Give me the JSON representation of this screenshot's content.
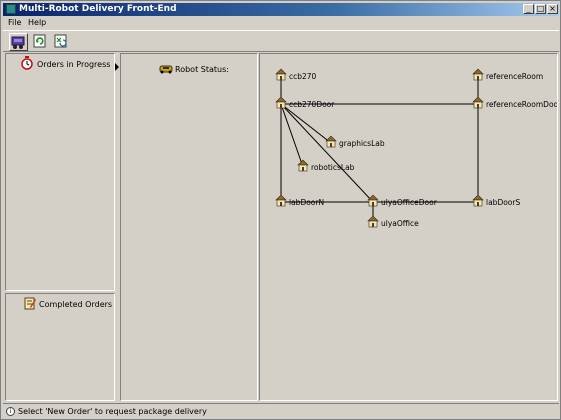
{
  "window": {
    "title": "Multi-Robot Delivery Front-End",
    "controls": [
      "_",
      "□",
      "×"
    ]
  },
  "menu": {
    "file": "File",
    "help": "Help"
  },
  "toolbar": {
    "buttons": [
      {
        "icon": "robot-cart-icon"
      },
      {
        "icon": "refresh-icon"
      },
      {
        "icon": "reset-icon"
      }
    ]
  },
  "left_panel": {
    "orders_in_progress": "Orders in Progress",
    "completed_orders": "Completed Orders"
  },
  "robot_panel": {
    "robot_status_label": "Robot Status:"
  },
  "map": {
    "nodes": [
      {
        "id": "ccb270",
        "label": "ccb270"
      },
      {
        "id": "referenceRoom",
        "label": "referenceRoom"
      },
      {
        "id": "ccb270Door",
        "label": "ccb270Door"
      },
      {
        "id": "referenceRoomDoor",
        "label": "referenceRoomDoor"
      },
      {
        "id": "graphicsLab",
        "label": "graphicsLab"
      },
      {
        "id": "roboticsLab",
        "label": "roboticsLab"
      },
      {
        "id": "labDoorN",
        "label": "labDoorN"
      },
      {
        "id": "ulyaOfficeDoor",
        "label": "ulyaOfficeDoor"
      },
      {
        "id": "labDoorS",
        "label": "labDoorS"
      },
      {
        "id": "ulyaOffice",
        "label": "ulyaOffice"
      }
    ],
    "edges": [
      [
        "ccb270",
        "ccb270Door"
      ],
      [
        "referenceRoom",
        "referenceRoomDoor"
      ],
      [
        "ccb270Door",
        "referenceRoomDoor"
      ],
      [
        "ccb270Door",
        "graphicsLab"
      ],
      [
        "ccb270Door",
        "roboticsLab"
      ],
      [
        "ccb270Door",
        "labDoorN"
      ],
      [
        "ccb270Door",
        "ulyaOfficeDoor"
      ],
      [
        "referenceRoomDoor",
        "labDoorS"
      ],
      [
        "labDoorN",
        "ulyaOfficeDoor"
      ],
      [
        "ulyaOfficeDoor",
        "labDoorS"
      ],
      [
        "ulyaOfficeDoor",
        "ulyaOffice"
      ]
    ]
  },
  "status_bar": {
    "text": "Select 'New Order' to request package delivery"
  },
  "colors": {
    "window_bg": "#d4d0c8",
    "title_bar": "#0a246a",
    "house_roof": "#8b6b2a",
    "house_body": "#f0e6c0"
  }
}
